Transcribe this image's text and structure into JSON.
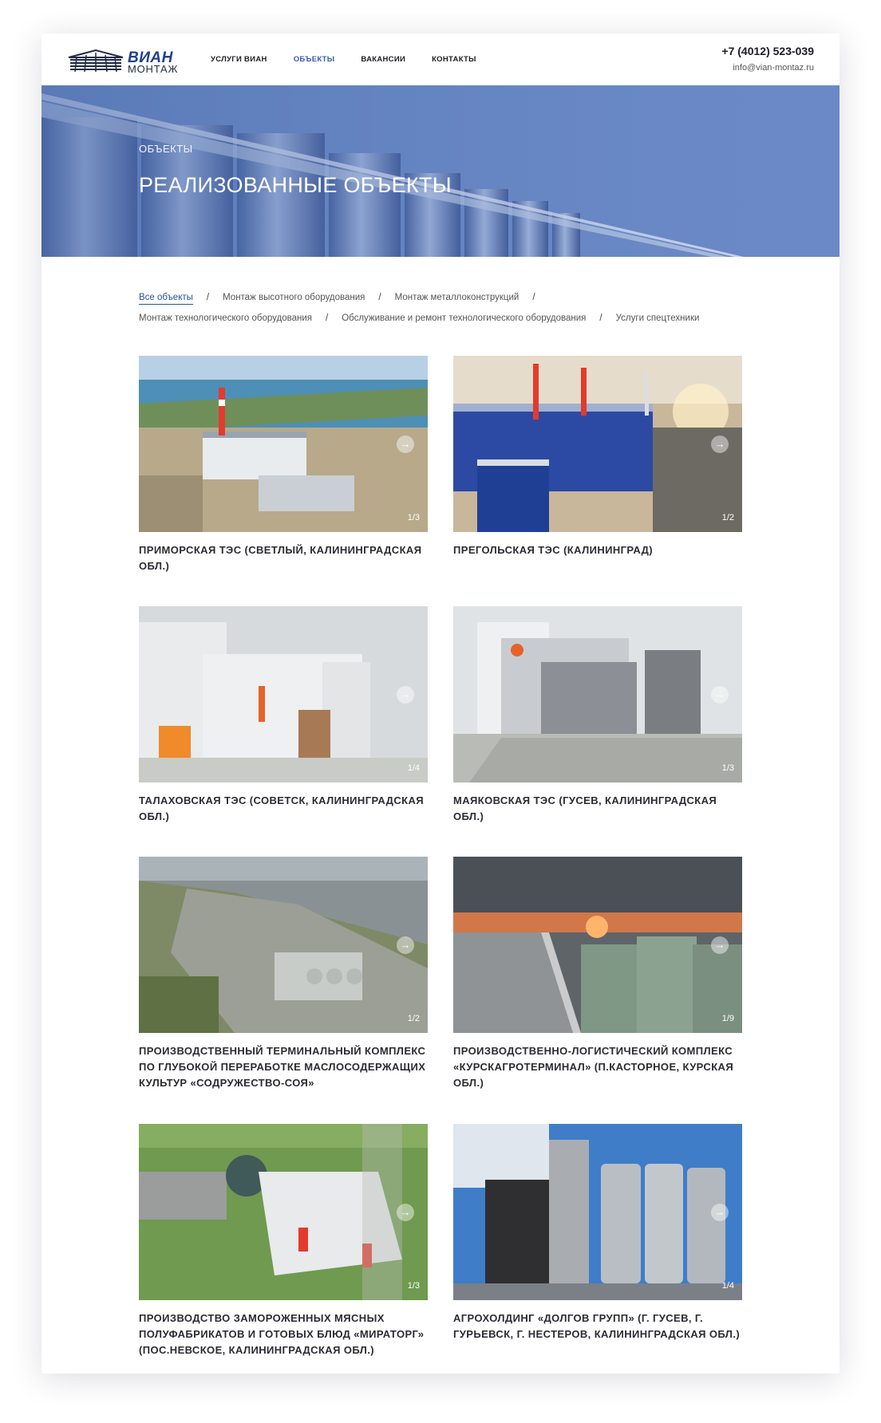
{
  "logo": {
    "line1": "ВИАН",
    "line2": "МОНТАЖ"
  },
  "nav": [
    {
      "label": "УСЛУГИ ВИАН",
      "active": false
    },
    {
      "label": "ОБЪЕКТЫ",
      "active": true
    },
    {
      "label": "ВАКАНСИИ",
      "active": false
    },
    {
      "label": "КОНТАКТЫ",
      "active": false
    }
  ],
  "contacts": {
    "phone": "+7 (4012) 523-039",
    "email": "info@vian-montaz.ru"
  },
  "hero": {
    "subtitle": "ОБЪЕКТЫ",
    "title": "РЕАЛИЗОВАННЫЕ ОБЪЕКТЫ"
  },
  "filters": [
    "Все объекты",
    "Монтаж высотного оборудования",
    "Монтаж металлоконструкций",
    "Монтаж технологического оборудования",
    "Обслуживание и ремонт технологического оборудования",
    "Услуги спецтехники"
  ],
  "projects": [
    {
      "title": "ПРИМОРСКАЯ ТЭС (СВЕТЛЫЙ, КАЛИНИНГРАДСКАЯ ОБЛ.)",
      "counter": "1/3"
    },
    {
      "title": "ПРЕГОЛЬСКАЯ ТЭС (КАЛИНИНГРАД)",
      "counter": "1/2"
    },
    {
      "title": "ТАЛАХОВСКАЯ ТЭС (СОВЕТСК, КАЛИНИНГРАДСКАЯ ОБЛ.)",
      "counter": "1/4"
    },
    {
      "title": "МАЯКОВСКАЯ ТЭС (ГУСЕВ, КАЛИНИНГРАДСКАЯ ОБЛ.)",
      "counter": "1/3"
    },
    {
      "title": "ПРОИЗВОДСТВЕННЫЙ ТЕРМИНАЛЬНЫЙ КОМПЛЕКС ПО ГЛУБОКОЙ ПЕРЕРАБОТКЕ МАСЛОСОДЕРЖАЩИХ КУЛЬТУР «СОДРУЖЕСТВО-СОЯ»",
      "counter": "1/2"
    },
    {
      "title": "ПРОИЗВОДСТВЕННО-ЛОГИСТИЧЕСКИЙ КОМПЛЕКС «КУРСКАГРОТЕРМИНАЛ» (П.КАСТОРНОЕ, КУРСКАЯ ОБЛ.)",
      "counter": "1/9"
    },
    {
      "title": "ПРОИЗВОДСТВО ЗАМОРОЖЕННЫХ МЯСНЫХ ПОЛУФАБРИКАТОВ И ГОТОВЫХ БЛЮД «МИРАТОРГ» (ПОС.НЕВСКОЕ, КАЛИНИНГРАДСКАЯ ОБЛ.)",
      "counter": "1/3"
    },
    {
      "title": "АГРОХОЛДИНГ «ДОЛГОВ ГРУПП» (Г. ГУСЕВ, Г. ГУРЬЕВСК, Г. НЕСТЕРОВ, КАЛИНИНГРАДСКАЯ ОБЛ.)",
      "counter": "1/4"
    }
  ],
  "colors": {
    "accent": "#2d4fa3",
    "hero": "#6a89c6"
  },
  "icons": {
    "slide_next": "arrow-right-icon"
  }
}
